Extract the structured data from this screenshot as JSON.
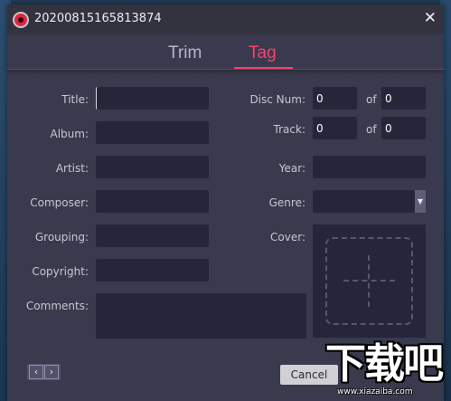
{
  "window": {
    "title": "20200815165813874",
    "close_glyph": "✕",
    "icon": "record-icon"
  },
  "tabs": [
    {
      "label": "Trim",
      "active": false
    },
    {
      "label": "Tag",
      "active": true
    }
  ],
  "fields": {
    "title": {
      "label": "Title:",
      "value": ""
    },
    "album": {
      "label": "Album:",
      "value": ""
    },
    "artist": {
      "label": "Artist:",
      "value": ""
    },
    "composer": {
      "label": "Composer:",
      "value": ""
    },
    "grouping": {
      "label": "Grouping:",
      "value": ""
    },
    "copyright": {
      "label": "Copyright:",
      "value": ""
    },
    "comments": {
      "label": "Comments:",
      "value": ""
    },
    "disc_num": {
      "label": "Disc Num:",
      "value": "0",
      "of_label": "of",
      "of_value": "0"
    },
    "track": {
      "label": "Track:",
      "value": "0",
      "of_label": "of",
      "of_value": "0"
    },
    "year": {
      "label": "Year:",
      "value": ""
    },
    "genre": {
      "label": "Genre:",
      "value": ""
    },
    "cover": {
      "label": "Cover:"
    }
  },
  "footer": {
    "prev_glyph": "‹",
    "next_glyph": "›",
    "cancel_label": "Cancel"
  },
  "watermark": {
    "logo_text": "下载吧",
    "url": "www.xiazaiba.com"
  },
  "colors": {
    "accent": "#f0456e",
    "dialog_bg": "#3a3a4e",
    "field_bg": "#26263a"
  }
}
